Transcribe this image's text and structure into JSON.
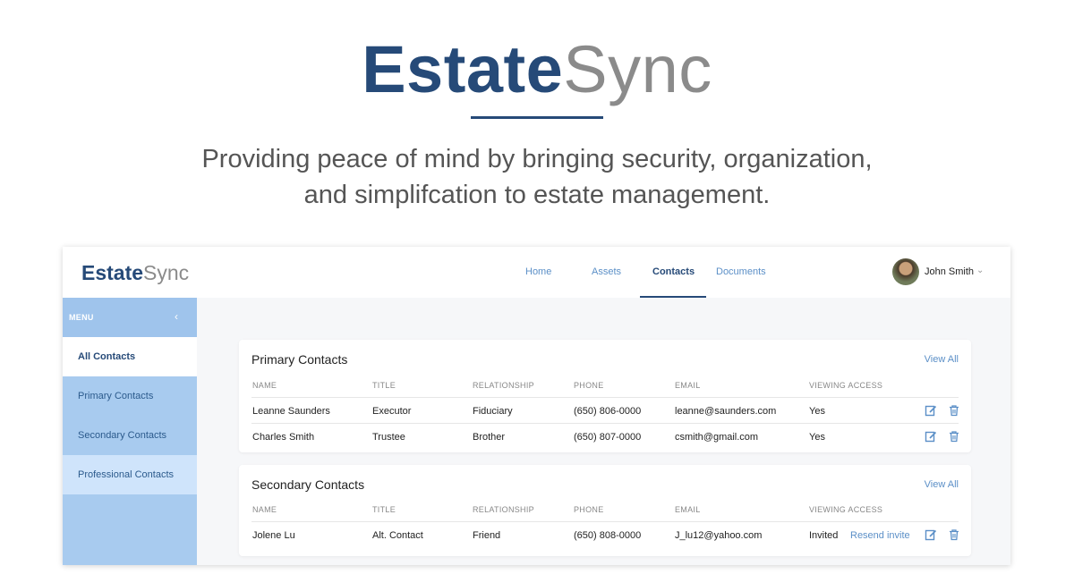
{
  "hero": {
    "logo_bold": "Estate",
    "logo_light": "Sync",
    "tagline_line1": "Providing peace of mind by bringing security, organization,",
    "tagline_line2": "and simplifcation to estate management."
  },
  "app": {
    "logo_bold": "Estate",
    "logo_light": "Sync",
    "nav": [
      {
        "label": "Home",
        "active": false
      },
      {
        "label": "Assets",
        "active": false
      },
      {
        "label": "Contacts",
        "active": true
      },
      {
        "label": "Documents",
        "active": false
      }
    ],
    "user": {
      "name": "John Smith",
      "chevron": "⌄"
    }
  },
  "sidebar": {
    "menu_label": "MENU",
    "collapse_icon": "‹",
    "items": [
      {
        "label": "All Contacts",
        "state": "active"
      },
      {
        "label": "Primary Contacts",
        "state": "normal"
      },
      {
        "label": "Secondary Contacts",
        "state": "normal"
      },
      {
        "label": "Professional Contacts",
        "state": "light"
      }
    ]
  },
  "columns": [
    "NAME",
    "TITLE",
    "RELATIONSHIP",
    "PHONE",
    "EMAIL",
    "VIEWING ACCESS"
  ],
  "primary": {
    "title": "Primary Contacts",
    "view_all": "View All",
    "rows": [
      {
        "name": "Leanne Saunders",
        "title": "Executor",
        "relationship": "Fiduciary",
        "phone": "(650) 806-0000",
        "email": "leanne@saunders.com",
        "access": "Yes"
      },
      {
        "name": "Charles Smith",
        "title": "Trustee",
        "relationship": "Brother",
        "phone": "(650) 807-0000",
        "email": "csmith@gmail.com",
        "access": "Yes"
      }
    ]
  },
  "secondary": {
    "title": "Secondary Contacts",
    "view_all": "View All",
    "rows": [
      {
        "name": "Jolene Lu",
        "title": "Alt. Contact",
        "relationship": "Friend",
        "phone": "(650) 808-0000",
        "email": "J_lu12@yahoo.com",
        "access": "Invited",
        "resend": "Resend invite"
      }
    ]
  },
  "icons": {
    "edit": "edit-icon",
    "delete": "trash-icon"
  },
  "colors": {
    "brand": "#264a78",
    "accent": "#5b8fc7",
    "sidebar": "#a8cbef"
  }
}
